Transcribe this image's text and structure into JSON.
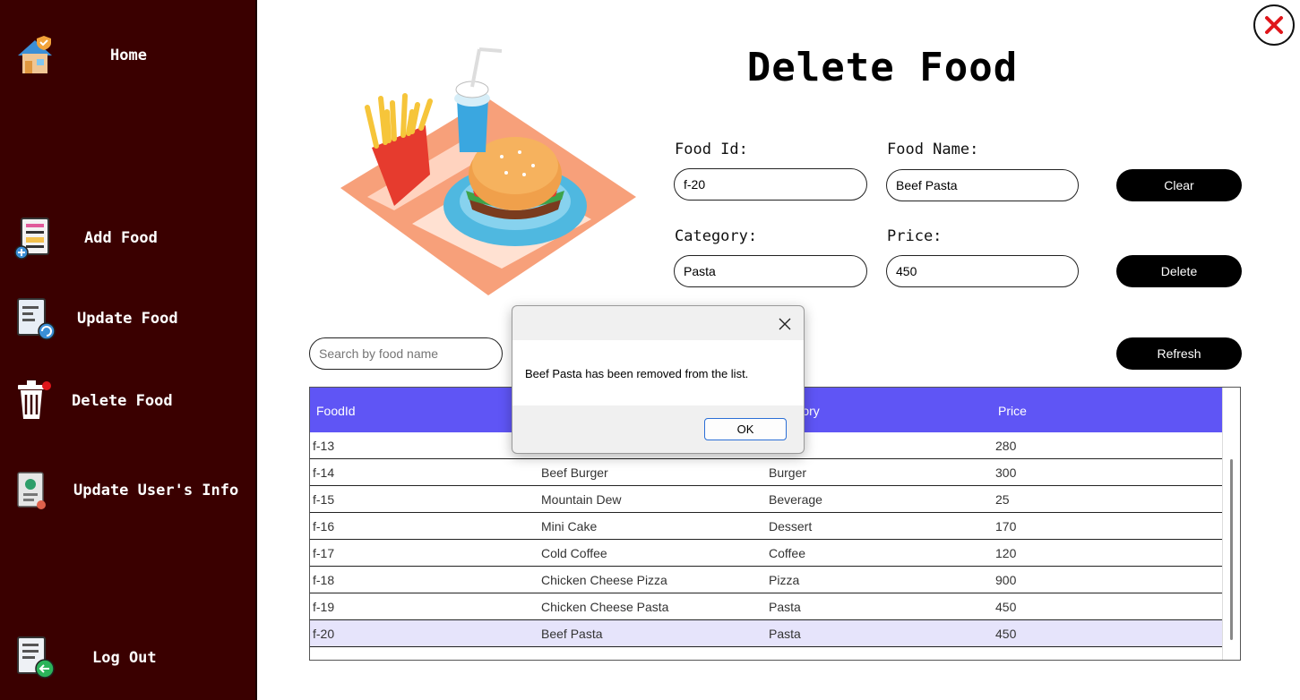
{
  "sidebar": {
    "items": [
      {
        "label": "Home",
        "icon": "home-icon"
      },
      {
        "label": "Add Food",
        "icon": "add-document-icon"
      },
      {
        "label": "Update Food",
        "icon": "update-document-icon"
      },
      {
        "label": "Delete Food",
        "icon": "trash-icon"
      },
      {
        "label": "Update User's Info",
        "icon": "user-card-icon"
      },
      {
        "label": "Log Out",
        "icon": "logout-icon"
      }
    ]
  },
  "header": {
    "title": "Delete Food",
    "close_icon": "close-icon"
  },
  "form": {
    "food_id": {
      "label": "Food Id:",
      "value": "f-20"
    },
    "food_name": {
      "label": "Food Name:",
      "value": "Beef Pasta"
    },
    "category": {
      "label": "Category:",
      "value": "Pasta"
    },
    "price": {
      "label": "Price:",
      "value": "450"
    },
    "clear_label": "Clear",
    "delete_label": "Delete",
    "refresh_label": "Refresh"
  },
  "search": {
    "placeholder": "Search by food name"
  },
  "table": {
    "columns": [
      "FoodId",
      "",
      "Category",
      "Price"
    ],
    "rows": [
      [
        "f-13",
        "",
        "",
        "280"
      ],
      [
        "f-14",
        "Beef Burger",
        "Burger",
        "300"
      ],
      [
        "f-15",
        "Mountain Dew",
        "Beverage",
        "25"
      ],
      [
        "f-16",
        "Mini Cake",
        "Dessert",
        "170"
      ],
      [
        "f-17",
        "Cold Coffee",
        "Coffee",
        "120"
      ],
      [
        "f-18",
        "Chicken Cheese Pizza",
        "Pizza",
        "900"
      ],
      [
        "f-19",
        "Chicken Cheese Pasta",
        "Pasta",
        "450"
      ],
      [
        "f-20",
        "Beef Pasta",
        "Pasta",
        "450"
      ]
    ],
    "selected_row": 7
  },
  "dialog": {
    "message": "Beef Pasta has been removed from the list.",
    "ok_label": "OK"
  },
  "colors": {
    "sidebar_bg": "#3a0000",
    "table_header": "#5f55f5",
    "selected_row": "#e6e4fb",
    "close_red": "#e0161b"
  }
}
